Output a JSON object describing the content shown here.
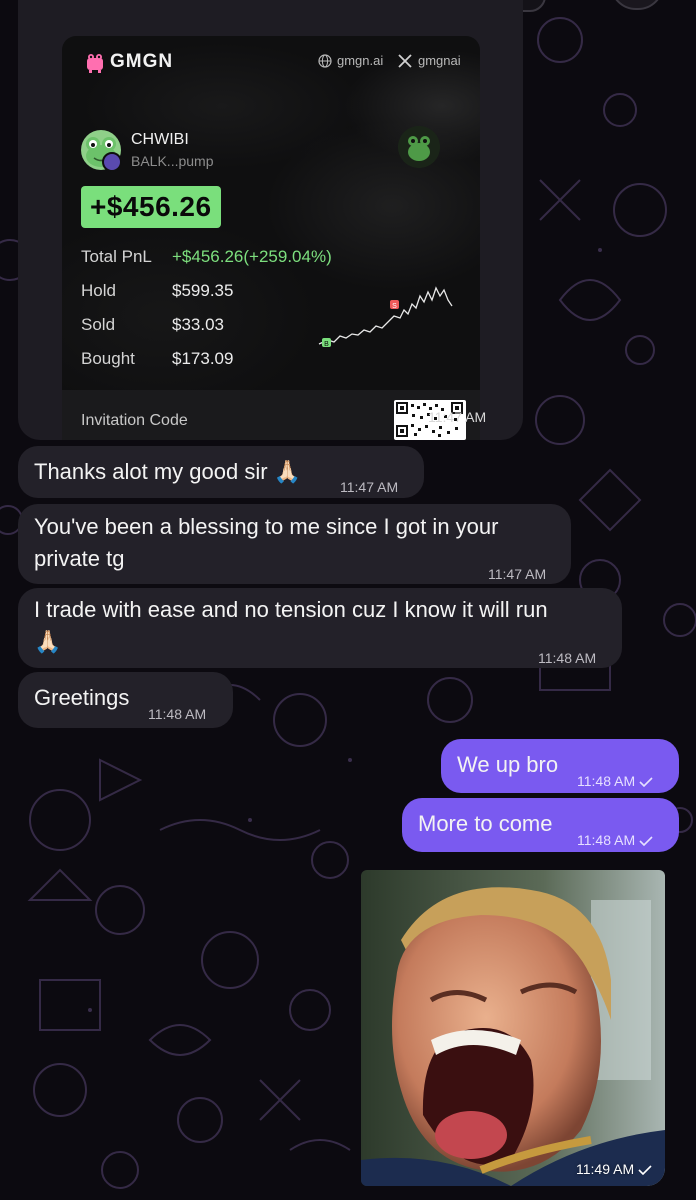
{
  "card": {
    "brand": "GMGN",
    "site": "gmgn.ai",
    "x_handle": "gmgnai",
    "token_name": "CHWIBI",
    "token_address": "BALK...pump",
    "pnl_headline": "+$456.26",
    "stats": [
      {
        "label": "Total PnL",
        "value": "+$456.26(+259.04%)"
      },
      {
        "label": "Hold",
        "value": "$599.35"
      },
      {
        "label": "Sold",
        "value": "$33.03"
      },
      {
        "label": "Bought",
        "value": "$173.09"
      }
    ],
    "chart_markers": {
      "buy": "B",
      "sell": "S"
    },
    "invitation_label": "Invitation Code",
    "time": "11:47 AM"
  },
  "messages": [
    {
      "text": "Thanks alot my good sir 🙏🏻",
      "time": "11:47 AM",
      "direction": "in"
    },
    {
      "text_line1": "You've been a blessing to me since I got in your",
      "text_line2": "private tg",
      "time": "11:47 AM",
      "direction": "in"
    },
    {
      "text_line1": "I trade with ease and no tension cuz I know it will run",
      "text_line2": "🙏🏻",
      "time": "11:48 AM",
      "direction": "in"
    },
    {
      "text": "Greetings",
      "time": "11:48 AM",
      "direction": "in"
    },
    {
      "text": "We up bro",
      "time": "11:48 AM",
      "direction": "out"
    },
    {
      "text": "More to come",
      "time": "11:48 AM",
      "direction": "out"
    }
  ],
  "photo_message": {
    "time": "11:49 AM"
  },
  "colors": {
    "background": "#0c0a10",
    "incoming_bubble": "#232129",
    "outgoing_bubble": "#7a5af0",
    "pnl_green": "#7adf7c"
  },
  "icons": [
    "globe-icon",
    "x-logo-icon",
    "read-check-icon",
    "praying-hands-emoji",
    "gmgn-frog-logo"
  ]
}
